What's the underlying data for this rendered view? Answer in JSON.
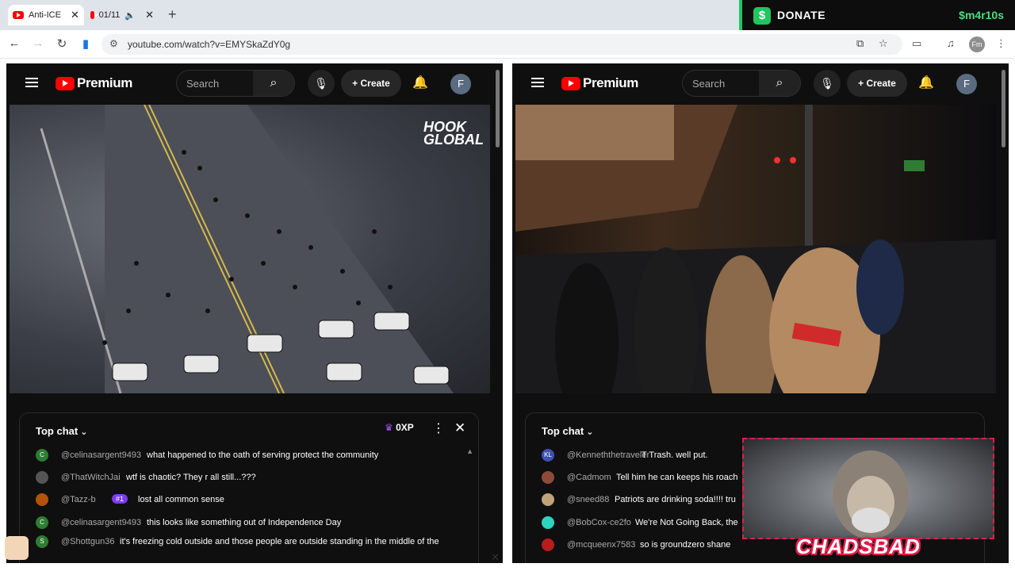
{
  "browser": {
    "tabs": [
      {
        "title": "Anti-ICE"
      },
      {
        "title": "01/11"
      }
    ],
    "url": "youtube.com/watch?v=EMYSkaZdY0g",
    "profile_initial": "Fm"
  },
  "donate": {
    "label": "DONATE",
    "code": "$m4r10s"
  },
  "panes": [
    {
      "logo_text": "Premium",
      "search_placeholder": "Search",
      "create_label": "Create",
      "avatar_initial": "F",
      "video_watermark": "HOOK GLOBAL",
      "chat": {
        "title": "Top chat",
        "xp": "0XP",
        "messages": [
          {
            "avatar": "C",
            "avatar_color": "#2e7d32",
            "author": "@celinasargent9493",
            "text": "what happened to the oath of serving protect the community"
          },
          {
            "avatar": "",
            "avatar_color": "#555555",
            "author": "@ThatWitchJai",
            "text": "wtf is chaotic? They r all still...???"
          },
          {
            "avatar": "",
            "avatar_color": "#b45309",
            "author": "@Tazz-b",
            "badge": "#1",
            "text": "lost all common sense"
          },
          {
            "avatar": "C",
            "avatar_color": "#2e7d32",
            "author": "@celinasargent9493",
            "text": "this looks like something out of Independence Day"
          },
          {
            "avatar": "S",
            "avatar_color": "#2e7d32",
            "author": "@Shottgun36",
            "text": "it's freezing cold outside and those people are outside standing in the middle of the"
          }
        ]
      }
    },
    {
      "logo_text": "Premium",
      "search_placeholder": "Search",
      "create_label": "Create",
      "avatar_initial": "F",
      "chat": {
        "title": "Top chat",
        "messages": [
          {
            "avatar": "KL",
            "avatar_color": "#3f51b5",
            "author": "@Kenneththetraveler",
            "text": "T Trash. well put."
          },
          {
            "avatar": "",
            "avatar_color": "#8d4a3a",
            "author": "@Cadmom",
            "text": "Tell him he can keeps his roach"
          },
          {
            "avatar": "",
            "avatar_color": "#c2a27a",
            "author": "@sneed88",
            "text": "Patriots are drinking soda!!!! tru"
          },
          {
            "avatar": "",
            "avatar_color": "#2dd4bf",
            "author": "@BobCox-ce2fo",
            "text": "We're Not Going Back, the"
          },
          {
            "avatar": "",
            "avatar_color": "#b91c1c",
            "author": "@mcqueenx7583",
            "text": "so is groundzero shane"
          }
        ]
      }
    }
  ],
  "streamer": {
    "name": "CHADSBAD"
  }
}
